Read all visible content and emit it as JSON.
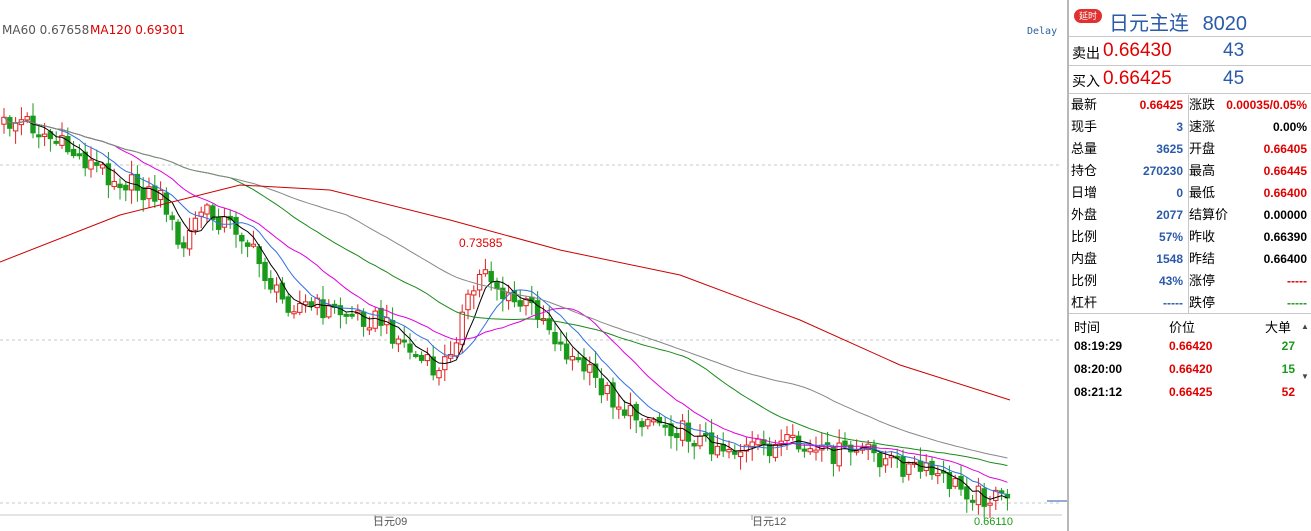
{
  "indicators": {
    "ma60": "MA60 0.67658",
    "ma120": "MA120 0.69301",
    "ma60_color": "#555555",
    "ma120_color": "#dd0000"
  },
  "delay_label": "Delay",
  "chart_data": {
    "type": "candlestick",
    "peak_label": "0.73585",
    "low_label": "0.66110",
    "x_labels": [
      "日元09",
      "日元12"
    ],
    "price_range": [
      0.66,
      0.76
    ],
    "colors": {
      "up": "#e02020",
      "down": "#1a9a1a",
      "ma_fast": "#000000",
      "ma_blue": "#3070e0",
      "ma_magenta": "#e000e0",
      "ma_green": "#1a8a1a",
      "ma_gray": "#888888",
      "ma_red": "#cc0000"
    }
  },
  "panel": {
    "delay_badge": "延时",
    "title": "日元主连",
    "code": "8020",
    "sell": {
      "label": "卖出",
      "price": "0.66430",
      "vol": "43"
    },
    "buy": {
      "label": "买入",
      "price": "0.66425",
      "vol": "45"
    },
    "stats_left": [
      {
        "k": "最新",
        "v": "0.66425",
        "c": "#e00000"
      },
      {
        "k": "现手",
        "v": "3",
        "c": "#2a5aa8"
      },
      {
        "k": "总量",
        "v": "3625",
        "c": "#2a5aa8"
      },
      {
        "k": "持仓",
        "v": "270230",
        "c": "#2a5aa8"
      },
      {
        "k": "日增",
        "v": "0",
        "c": "#2a5aa8"
      },
      {
        "k": "外盘",
        "v": "2077",
        "c": "#2a5aa8"
      },
      {
        "k": "比例",
        "v": "57%",
        "c": "#2a5aa8"
      },
      {
        "k": "内盘",
        "v": "1548",
        "c": "#2a5aa8"
      },
      {
        "k": "比例",
        "v": "43%",
        "c": "#2a5aa8"
      },
      {
        "k": "杠杆",
        "v": "-----",
        "c": "#2a5aa8"
      }
    ],
    "stats_right": [
      {
        "k": "涨跌",
        "v": "0.00035/0.05%",
        "c": "#e00000"
      },
      {
        "k": "速涨",
        "v": "0.00%",
        "c": "#000000"
      },
      {
        "k": "开盘",
        "v": "0.66405",
        "c": "#e00000"
      },
      {
        "k": "最高",
        "v": "0.66445",
        "c": "#e00000"
      },
      {
        "k": "最低",
        "v": "0.66400",
        "c": "#e00000"
      },
      {
        "k": "结算价",
        "v": "0.00000",
        "c": "#000000"
      },
      {
        "k": "昨收",
        "v": "0.66390",
        "c": "#000000"
      },
      {
        "k": "昨结",
        "v": "0.66400",
        "c": "#000000"
      },
      {
        "k": "涨停",
        "v": "-----",
        "c": "#e00000"
      },
      {
        "k": "跌停",
        "v": "-----",
        "c": "#1a9a1a"
      }
    ],
    "ticks_header": {
      "time": "时间",
      "price": "价位",
      "vol": "大单"
    },
    "ticks": [
      {
        "time": "08:19:29",
        "price": "0.66420",
        "vol": "27",
        "vc": "#1a9a1a"
      },
      {
        "time": "08:20:00",
        "price": "0.66420",
        "vol": "15",
        "vc": "#1a9a1a"
      },
      {
        "time": "08:21:12",
        "price": "0.66425",
        "vol": "52",
        "vc": "#e00000"
      }
    ]
  }
}
